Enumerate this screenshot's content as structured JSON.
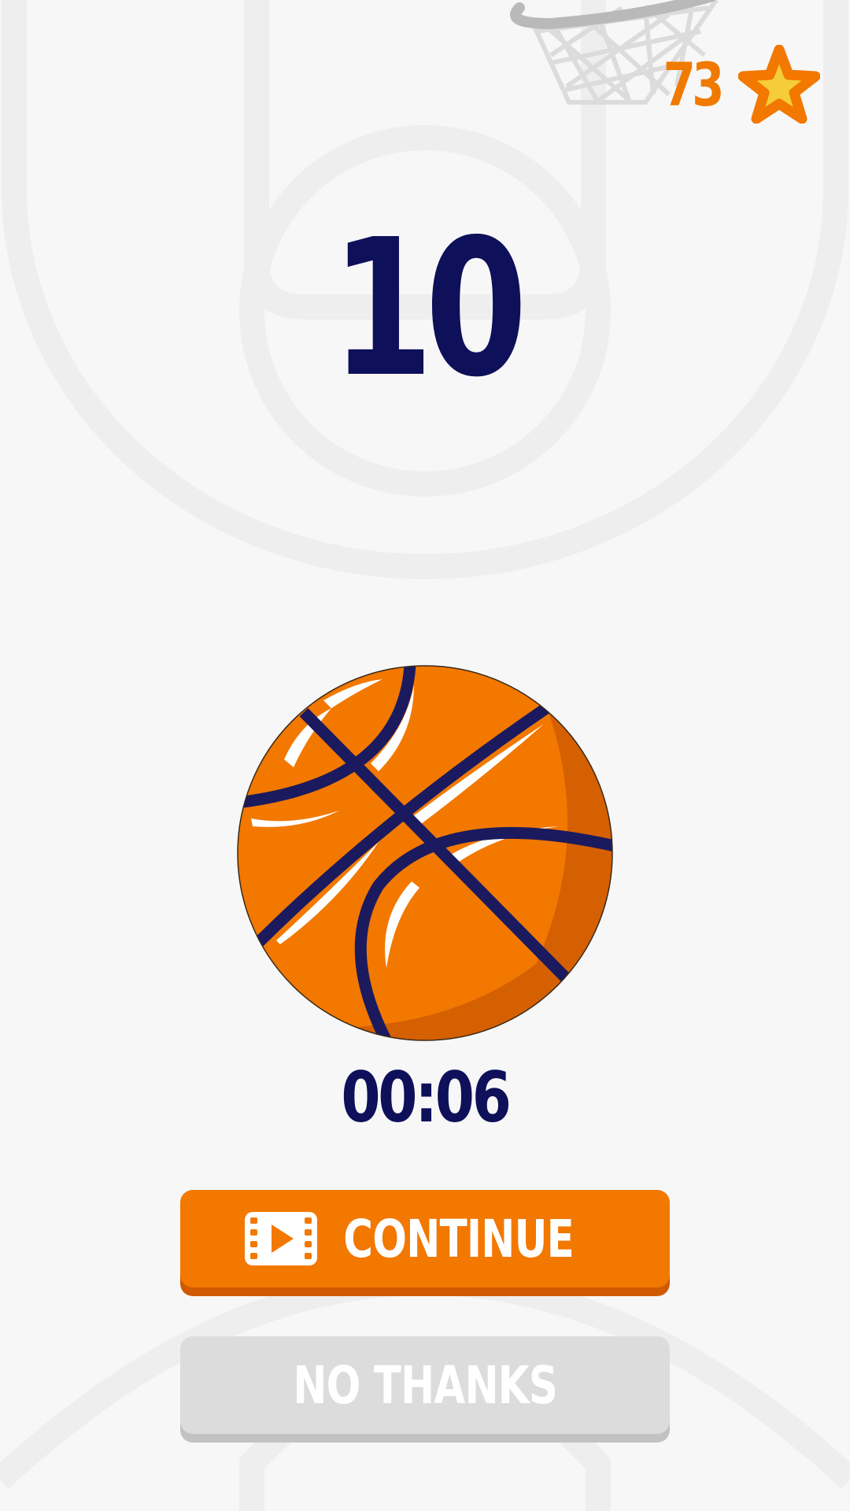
{
  "hud": {
    "star_count": "73",
    "star_icon": "star-icon"
  },
  "game": {
    "score": "10",
    "timer": "00:06"
  },
  "buttons": {
    "continue_label": "CONTINUE",
    "continue_icon": "video-play-icon",
    "no_thanks_label": "NO THANKS"
  },
  "colors": {
    "background": "#f7f7f7",
    "accent_orange": "#f27800",
    "navy": "#0f105a",
    "star_yellow": "#f5cd3a",
    "disabled_gray": "#dcdcdc"
  }
}
